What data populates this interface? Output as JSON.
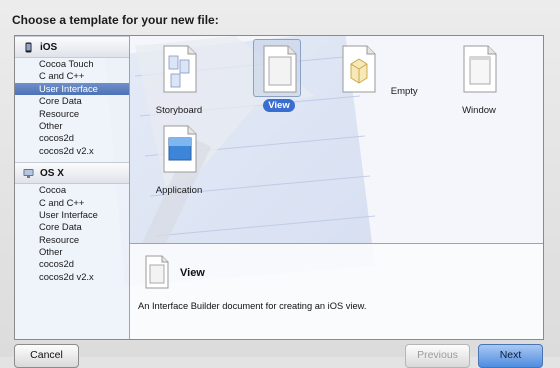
{
  "dialog": {
    "title": "Choose a template for your new file:"
  },
  "sidebar": {
    "groups": [
      {
        "name": "iOS",
        "icon": "iphone-icon",
        "items": [
          "Cocoa Touch",
          "C and C++",
          "User Interface",
          "Core Data",
          "Resource",
          "Other",
          "cocos2d",
          "cocos2d v2.x"
        ],
        "selected": "User Interface"
      },
      {
        "name": "OS X",
        "icon": "mac-icon",
        "items": [
          "Cocoa",
          "C and C++",
          "User Interface",
          "Core Data",
          "Resource",
          "Other",
          "cocos2d",
          "cocos2d v2.x"
        ]
      }
    ]
  },
  "templates": [
    {
      "label": "Storyboard",
      "icon": "storyboard-icon"
    },
    {
      "label": "View",
      "icon": "view-file-icon",
      "selected": true
    },
    {
      "label": "Empty",
      "icon": "empty-file-icon"
    },
    {
      "label": "Window",
      "icon": "window-file-icon"
    },
    {
      "label": "Application",
      "icon": "application-file-icon"
    }
  ],
  "description": {
    "title": "View",
    "text": "An Interface Builder document for creating an iOS view."
  },
  "buttons": {
    "cancel": "Cancel",
    "previous": "Previous",
    "next": "Next"
  },
  "colors": {
    "selection": "#4d72b5",
    "selected_label": "#3a6dd0",
    "next_button": "#4f8de0"
  }
}
